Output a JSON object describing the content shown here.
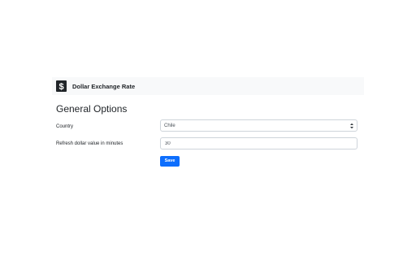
{
  "navbar": {
    "logo_icon": "dollar-sign-icon",
    "brand": "Dollar Exchange Rate",
    "background": "#f8f9fa"
  },
  "page": {
    "heading": "General Options"
  },
  "form": {
    "country_label": "Country",
    "country_value": "Chile",
    "country_icon": "select-arrows-icon",
    "refresh_label": "Refresh dollar value in minutes",
    "refresh_value": "30",
    "save_label": "Save",
    "save_color": "#0d6efd"
  }
}
